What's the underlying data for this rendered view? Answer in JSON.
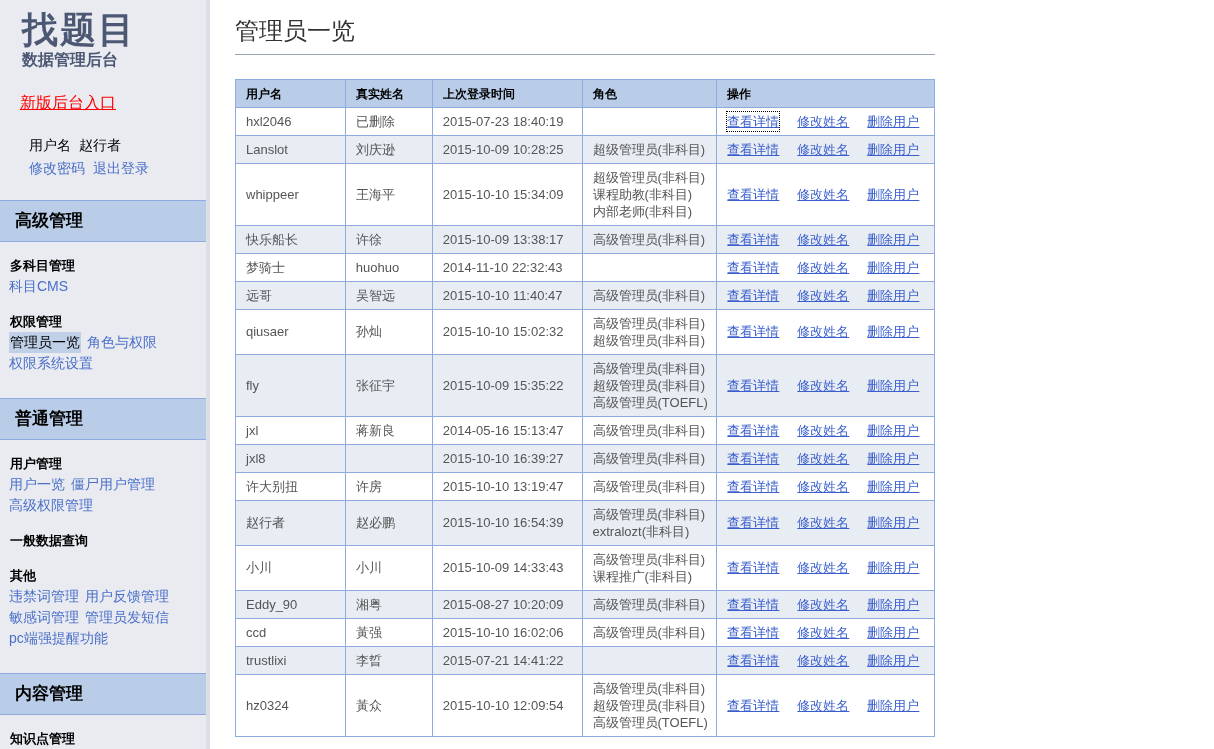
{
  "sidebar": {
    "logo": "找题目",
    "subtitle": "数据管理后台",
    "new_entry_link": "新版后台入口",
    "user": {
      "label": "用户名",
      "name": "赵行者"
    },
    "account_links": [
      "修改密码",
      "退出登录"
    ],
    "sections": [
      {
        "title": "高级管理",
        "groups": [
          {
            "title": "多科目管理",
            "lines": [
              [
                {
                  "label": "科目CMS",
                  "selected": false
                }
              ]
            ]
          },
          {
            "title": "权限管理",
            "lines": [
              [
                {
                  "label": "管理员一览",
                  "selected": true
                },
                {
                  "label": "角色与权限",
                  "selected": false
                }
              ],
              [
                {
                  "label": "权限系统设置",
                  "selected": false
                }
              ]
            ]
          }
        ]
      },
      {
        "title": "普通管理",
        "groups": [
          {
            "title": "用户管理",
            "lines": [
              [
                {
                  "label": "用户一览",
                  "selected": false
                },
                {
                  "label": "僵尸用户管理",
                  "selected": false
                }
              ],
              [
                {
                  "label": "高级权限管理",
                  "selected": false
                }
              ]
            ]
          },
          {
            "title": "一般数据查询"
          },
          {
            "title": "其他",
            "lines": [
              [
                {
                  "label": "违禁词管理",
                  "selected": false
                },
                {
                  "label": "用户反馈管理",
                  "selected": false
                }
              ],
              [
                {
                  "label": "敏感词管理",
                  "selected": false
                },
                {
                  "label": "管理员发短信",
                  "selected": false
                }
              ],
              [
                {
                  "label": "pc端强提醒功能",
                  "selected": false
                }
              ]
            ]
          }
        ]
      },
      {
        "title": "内容管理",
        "groups": [
          {
            "title": "知识点管理"
          }
        ]
      }
    ]
  },
  "page_title": "管理员一览",
  "table": {
    "columns": [
      "用户名",
      "真实姓名",
      "上次登录时间",
      "角色",
      "操作"
    ],
    "rows": [
      {
        "username": "hxl2046",
        "real_name": "已删除",
        "last_login": "2015-07-23 18:40:19",
        "roles": [],
        "actions": [
          {
            "label": "查看详情",
            "focused": true
          },
          {
            "label": "修改姓名",
            "focused": false
          },
          {
            "label": "删除用户",
            "focused": false
          }
        ]
      },
      {
        "username": "Lanslot",
        "real_name": "刘庆逊",
        "last_login": "2015-10-09 10:28:25",
        "roles": [
          "超级管理员(非科目)"
        ],
        "actions": [
          {
            "label": "查看详情",
            "focused": false
          },
          {
            "label": "修改姓名",
            "focused": false
          },
          {
            "label": "删除用户",
            "focused": false
          }
        ]
      },
      {
        "username": "whippeer",
        "real_name": "王海平",
        "last_login": "2015-10-10 15:34:09",
        "roles": [
          "超级管理员(非科目)",
          "课程助教(非科目)",
          "内部老师(非科目)"
        ],
        "actions": [
          {
            "label": "查看详情",
            "focused": false
          },
          {
            "label": "修改姓名",
            "focused": false
          },
          {
            "label": "删除用户",
            "focused": false
          }
        ]
      },
      {
        "username": "快乐船长",
        "real_name": "许徐",
        "last_login": "2015-10-09 13:38:17",
        "roles": [
          "高级管理员(非科目)"
        ],
        "actions": [
          {
            "label": "查看详情",
            "focused": false
          },
          {
            "label": "修改姓名",
            "focused": false
          },
          {
            "label": "删除用户",
            "focused": false
          }
        ]
      },
      {
        "username": "梦骑士",
        "real_name": "huohuo",
        "last_login": "2014-11-10 22:32:43",
        "roles": [],
        "actions": [
          {
            "label": "查看详情",
            "focused": false
          },
          {
            "label": "修改姓名",
            "focused": false
          },
          {
            "label": "删除用户",
            "focused": false
          }
        ]
      },
      {
        "username": "远哥",
        "real_name": "吴智远",
        "last_login": "2015-10-10 11:40:47",
        "roles": [
          "高级管理员(非科目)"
        ],
        "actions": [
          {
            "label": "查看详情",
            "focused": false
          },
          {
            "label": "修改姓名",
            "focused": false
          },
          {
            "label": "删除用户",
            "focused": false
          }
        ]
      },
      {
        "username": "qiusaer",
        "real_name": "孙灿",
        "last_login": "2015-10-10 15:02:32",
        "roles": [
          "高级管理员(非科目)",
          "超级管理员(非科目)"
        ],
        "actions": [
          {
            "label": "查看详情",
            "focused": false
          },
          {
            "label": "修改姓名",
            "focused": false
          },
          {
            "label": "删除用户",
            "focused": false
          }
        ]
      },
      {
        "username": "fly",
        "real_name": "张征宇",
        "last_login": "2015-10-09 15:35:22",
        "roles": [
          "高级管理员(非科目)",
          "超级管理员(非科目)",
          "高级管理员(TOEFL)"
        ],
        "actions": [
          {
            "label": "查看详情",
            "focused": false
          },
          {
            "label": "修改姓名",
            "focused": false
          },
          {
            "label": "删除用户",
            "focused": false
          }
        ]
      },
      {
        "username": "jxl",
        "real_name": "蒋新良",
        "last_login": "2014-05-16 15:13:47",
        "roles": [
          "高级管理员(非科目)"
        ],
        "actions": [
          {
            "label": "查看详情",
            "focused": false
          },
          {
            "label": "修改姓名",
            "focused": false
          },
          {
            "label": "删除用户",
            "focused": false
          }
        ]
      },
      {
        "username": "jxl8",
        "last_login": "2015-10-10 16:39:27",
        "roles": [
          "高级管理员(非科目)"
        ],
        "actions": [
          {
            "label": "查看详情",
            "focused": false
          },
          {
            "label": "修改姓名",
            "focused": false
          },
          {
            "label": "删除用户",
            "focused": false
          }
        ]
      },
      {
        "username": "许大别扭",
        "real_name": "许房",
        "last_login": "2015-10-10 13:19:47",
        "roles": [
          "高级管理员(非科目)"
        ],
        "actions": [
          {
            "label": "查看详情",
            "focused": false
          },
          {
            "label": "修改姓名",
            "focused": false
          },
          {
            "label": "删除用户",
            "focused": false
          }
        ]
      },
      {
        "username": "赵行者",
        "real_name": "赵必鹏",
        "last_login": "2015-10-10 16:54:39",
        "roles": [
          "高级管理员(非科目)",
          "extralozt(非科目)"
        ],
        "actions": [
          {
            "label": "查看详情",
            "focused": false
          },
          {
            "label": "修改姓名",
            "focused": false
          },
          {
            "label": "删除用户",
            "focused": false
          }
        ]
      },
      {
        "username": "小川",
        "real_name": "小川",
        "last_login": "2015-10-09 14:33:43",
        "roles": [
          "高级管理员(非科目)",
          "课程推广(非科目)"
        ],
        "actions": [
          {
            "label": "查看详情",
            "focused": false
          },
          {
            "label": "修改姓名",
            "focused": false
          },
          {
            "label": "删除用户",
            "focused": false
          }
        ]
      },
      {
        "username": "Eddy_90",
        "real_name": "湘粤",
        "last_login": "2015-08-27 10:20:09",
        "roles": [
          "高级管理员(非科目)"
        ],
        "actions": [
          {
            "label": "查看详情",
            "focused": false
          },
          {
            "label": "修改姓名",
            "focused": false
          },
          {
            "label": "删除用户",
            "focused": false
          }
        ]
      },
      {
        "username": "ccd",
        "real_name": "黃强",
        "last_login": "2015-10-10 16:02:06",
        "roles": [
          "高级管理员(非科目)"
        ],
        "actions": [
          {
            "label": "查看详情",
            "focused": false
          },
          {
            "label": "修改姓名",
            "focused": false
          },
          {
            "label": "删除用户",
            "focused": false
          }
        ]
      },
      {
        "username": "trustlixi",
        "real_name": "李晢",
        "last_login": "2015-07-21 14:41:22",
        "roles": [],
        "actions": [
          {
            "label": "查看详情",
            "focused": false
          },
          {
            "label": "修改姓名",
            "focused": false
          },
          {
            "label": "删除用户",
            "focused": false
          }
        ]
      },
      {
        "username": "hz0324",
        "real_name": "黃众",
        "last_login": "2015-10-10 12:09:54",
        "roles": [
          "高级管理员(非科目)",
          "超级管理员(非科目)",
          "高级管理员(TOEFL)"
        ],
        "actions": [
          {
            "label": "查看详情",
            "focused": false
          },
          {
            "label": "修改姓名",
            "focused": false
          },
          {
            "label": "删除用户",
            "focused": false
          }
        ]
      }
    ]
  }
}
